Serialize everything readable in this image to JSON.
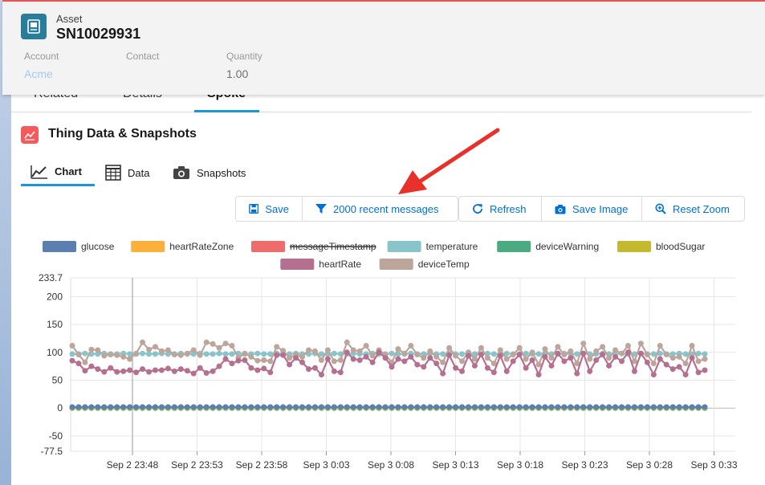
{
  "header": {
    "label": "Asset",
    "title": "SN10029931",
    "fields": [
      {
        "label": "Account",
        "value": "Acme"
      },
      {
        "label": "Contact",
        "value": ""
      },
      {
        "label": "Quantity",
        "value": "1.00"
      }
    ]
  },
  "tabs": [
    {
      "label": "Related"
    },
    {
      "label": "Details"
    },
    {
      "label": "Spoke"
    }
  ],
  "section": {
    "title": "Thing Data & Snapshots"
  },
  "subtabs": [
    {
      "label": "Chart"
    },
    {
      "label": "Data"
    },
    {
      "label": "Snapshots"
    }
  ],
  "toolbar": {
    "save": "Save",
    "filter": "2000 recent messages",
    "refresh": "Refresh",
    "save_image": "Save Image",
    "reset_zoom": "Reset Zoom"
  },
  "colors": {
    "accent": "#0070d2",
    "section_icon": "#f6595b",
    "asset_icon": "#2a7c9b",
    "arrow": "#e8312a"
  },
  "chart_data": {
    "type": "line",
    "xlabel": "",
    "ylabel": "",
    "ylim": [
      -77.5,
      233.7
    ],
    "y_ticks": [
      233.7,
      200,
      150,
      100,
      50,
      0,
      -50,
      -77.5
    ],
    "x_ticks": [
      "Sep 2 23:48",
      "Sep 2 23:53",
      "Sep 2 23:58",
      "Sep 3 0:03",
      "Sep 3 0:08",
      "Sep 3 0:13",
      "Sep 3 0:18",
      "Sep 3 0:23",
      "Sep 3 0:28",
      "Sep 3 0:33"
    ],
    "grid": true,
    "legend_position": "top",
    "series": [
      {
        "name": "glucose",
        "color": "#5b7faf",
        "hidden": false,
        "values": [
          2,
          2,
          2,
          2,
          2,
          2,
          2,
          2,
          2,
          2,
          2,
          2,
          2,
          2,
          2,
          2,
          2,
          2,
          2,
          2,
          2,
          2,
          2,
          2,
          2,
          2,
          2,
          2,
          2,
          2,
          2,
          2,
          2,
          2,
          2,
          2,
          2,
          2,
          2,
          2,
          2,
          2,
          2,
          2,
          2,
          2,
          2,
          2,
          2,
          2,
          2,
          2,
          2,
          2,
          2,
          2,
          2,
          2,
          2,
          2,
          2,
          2,
          2,
          2,
          2,
          2,
          2,
          2,
          2,
          2,
          2,
          2,
          2,
          2,
          2,
          2,
          2,
          2,
          2,
          2,
          2,
          2,
          2,
          2,
          2,
          2,
          2,
          2,
          2,
          2,
          2,
          2,
          2,
          2,
          2,
          2,
          2,
          2,
          2,
          2
        ]
      },
      {
        "name": "heartRateZone",
        "color": "#fbb03b",
        "hidden": false,
        "values": [
          0,
          0,
          0,
          0,
          0,
          0,
          0,
          0,
          0,
          0,
          0,
          0,
          0,
          0,
          0,
          0,
          0,
          0,
          0,
          0,
          0,
          0,
          0,
          0,
          0,
          0,
          0,
          0,
          0,
          0,
          0,
          0,
          0,
          0,
          0,
          0,
          0,
          0,
          0,
          0,
          0,
          0,
          0,
          0,
          0,
          0,
          0,
          0,
          0,
          0,
          0,
          0,
          0,
          0,
          0,
          0,
          0,
          0,
          0,
          0,
          0,
          0,
          0,
          0,
          0,
          0,
          0,
          0,
          0,
          0,
          0,
          0,
          0,
          0,
          0,
          0,
          0,
          0,
          0,
          0,
          0,
          0,
          0,
          0,
          0,
          0,
          0,
          0,
          0,
          0,
          0,
          0,
          0,
          0,
          0,
          0,
          0,
          0,
          0,
          0
        ]
      },
      {
        "name": "messageTimestamp",
        "color": "#ef6c6c",
        "hidden": true,
        "values": []
      },
      {
        "name": "temperature",
        "color": "#89c4cb",
        "hidden": false,
        "values": [
          97,
          97,
          98,
          97,
          97,
          98,
          97,
          97,
          98,
          97,
          97,
          98,
          97,
          97,
          98,
          97,
          97,
          98,
          97,
          97,
          98,
          97,
          97,
          98,
          97,
          97,
          98,
          97,
          97,
          98,
          97,
          97,
          98,
          97,
          97,
          98,
          97,
          97,
          98,
          97,
          97,
          98,
          97,
          97,
          98,
          97,
          97,
          98,
          97,
          97,
          98,
          97,
          97,
          98,
          97,
          97,
          98,
          97,
          97,
          98,
          97,
          97,
          98,
          97,
          97,
          98,
          97,
          97,
          98,
          97,
          97,
          98,
          97,
          97,
          98,
          97,
          97,
          98,
          97,
          97,
          98,
          97,
          97,
          98,
          97,
          97,
          98,
          97,
          97,
          98,
          97,
          97,
          98,
          97,
          97,
          98,
          97,
          97,
          98,
          97
        ]
      },
      {
        "name": "deviceWarning",
        "color": "#4aab82",
        "hidden": false,
        "values": [
          0,
          0,
          0,
          0,
          0,
          0,
          0,
          0,
          0,
          0,
          0,
          0,
          0,
          0,
          0,
          0,
          0,
          0,
          0,
          0,
          0,
          0,
          0,
          0,
          0,
          0,
          0,
          0,
          0,
          0,
          0,
          0,
          0,
          0,
          0,
          0,
          0,
          0,
          0,
          0,
          0,
          0,
          0,
          0,
          0,
          0,
          0,
          0,
          0,
          0,
          0,
          0,
          0,
          0,
          0,
          0,
          0,
          0,
          0,
          0,
          0,
          0,
          0,
          0,
          0,
          0,
          0,
          0,
          0,
          0,
          0,
          0,
          0,
          0,
          0,
          0,
          0,
          0,
          0,
          0,
          0,
          0,
          0,
          0,
          0,
          0,
          0,
          0,
          0,
          0,
          0,
          0,
          0,
          0,
          0,
          0,
          0,
          0,
          0,
          0
        ]
      },
      {
        "name": "bloodSugar",
        "color": "#c2b92f",
        "hidden": false,
        "values": [
          1,
          1,
          1,
          1,
          1,
          1,
          1,
          1,
          1,
          1,
          1,
          1,
          1,
          1,
          1,
          1,
          1,
          1,
          1,
          1,
          1,
          1,
          1,
          1,
          1,
          1,
          1,
          1,
          1,
          1,
          1,
          1,
          1,
          1,
          1,
          1,
          1,
          1,
          1,
          1,
          1,
          1,
          1,
          1,
          1,
          1,
          1,
          1,
          1,
          1,
          1,
          1,
          1,
          1,
          1,
          1,
          1,
          1,
          1,
          1,
          1,
          1,
          1,
          1,
          1,
          1,
          1,
          1,
          1,
          1,
          1,
          1,
          1,
          1,
          1,
          1,
          1,
          1,
          1,
          1,
          1,
          1,
          1,
          1,
          1,
          1,
          1,
          1,
          1,
          1,
          1,
          1,
          1,
          1,
          1,
          1,
          1,
          1,
          1,
          1
        ]
      },
      {
        "name": "heartRate",
        "color": "#b5708f",
        "hidden": false,
        "values": [
          85,
          80,
          67,
          75,
          70,
          65,
          72,
          65,
          66,
          68,
          64,
          70,
          65,
          68,
          68,
          71,
          66,
          70,
          67,
          62,
          72,
          63,
          66,
          75,
          88,
          80,
          85,
          86,
          72,
          68,
          71,
          64,
          95,
          95,
          78,
          90,
          82,
          70,
          72,
          60,
          88,
          66,
          64,
          100,
          88,
          86,
          92,
          82,
          100,
          90,
          74,
          88,
          84,
          92,
          78,
          74,
          90,
          80,
          62,
          95,
          72,
          66,
          94,
          76,
          96,
          72,
          64,
          94,
          66,
          84,
          96,
          72,
          86,
          60,
          92,
          76,
          98,
          84,
          90,
          62,
          98,
          66,
          86,
          96,
          76,
          92,
          84,
          100,
          66,
          98,
          82,
          60,
          88,
          78,
          70,
          74,
          60,
          90,
          64,
          68
        ]
      },
      {
        "name": "deviceTemp",
        "color": "#bda59c",
        "hidden": false,
        "values": [
          112,
          96,
          82,
          105,
          104,
          94,
          96,
          95,
          92,
          88,
          98,
          118,
          105,
          110,
          102,
          104,
          96,
          95,
          98,
          104,
          95,
          118,
          115,
          108,
          116,
          112,
          90,
          98,
          92,
          85,
          86,
          84,
          110,
          103,
          90,
          96,
          92,
          104,
          102,
          86,
          104,
          84,
          86,
          118,
          104,
          102,
          112,
          94,
          104,
          96,
          82,
          106,
          98,
          112,
          96,
          90,
          102,
          92,
          82,
          108,
          94,
          84,
          100,
          88,
          108,
          90,
          80,
          104,
          88,
          96,
          108,
          88,
          100,
          78,
          106,
          90,
          110,
          96,
          102,
          80,
          116,
          88,
          102,
          110,
          90,
          104,
          98,
          112,
          84,
          116,
          96,
          80,
          112,
          96,
          90,
          92,
          80,
          112,
          84,
          88
        ]
      }
    ]
  }
}
